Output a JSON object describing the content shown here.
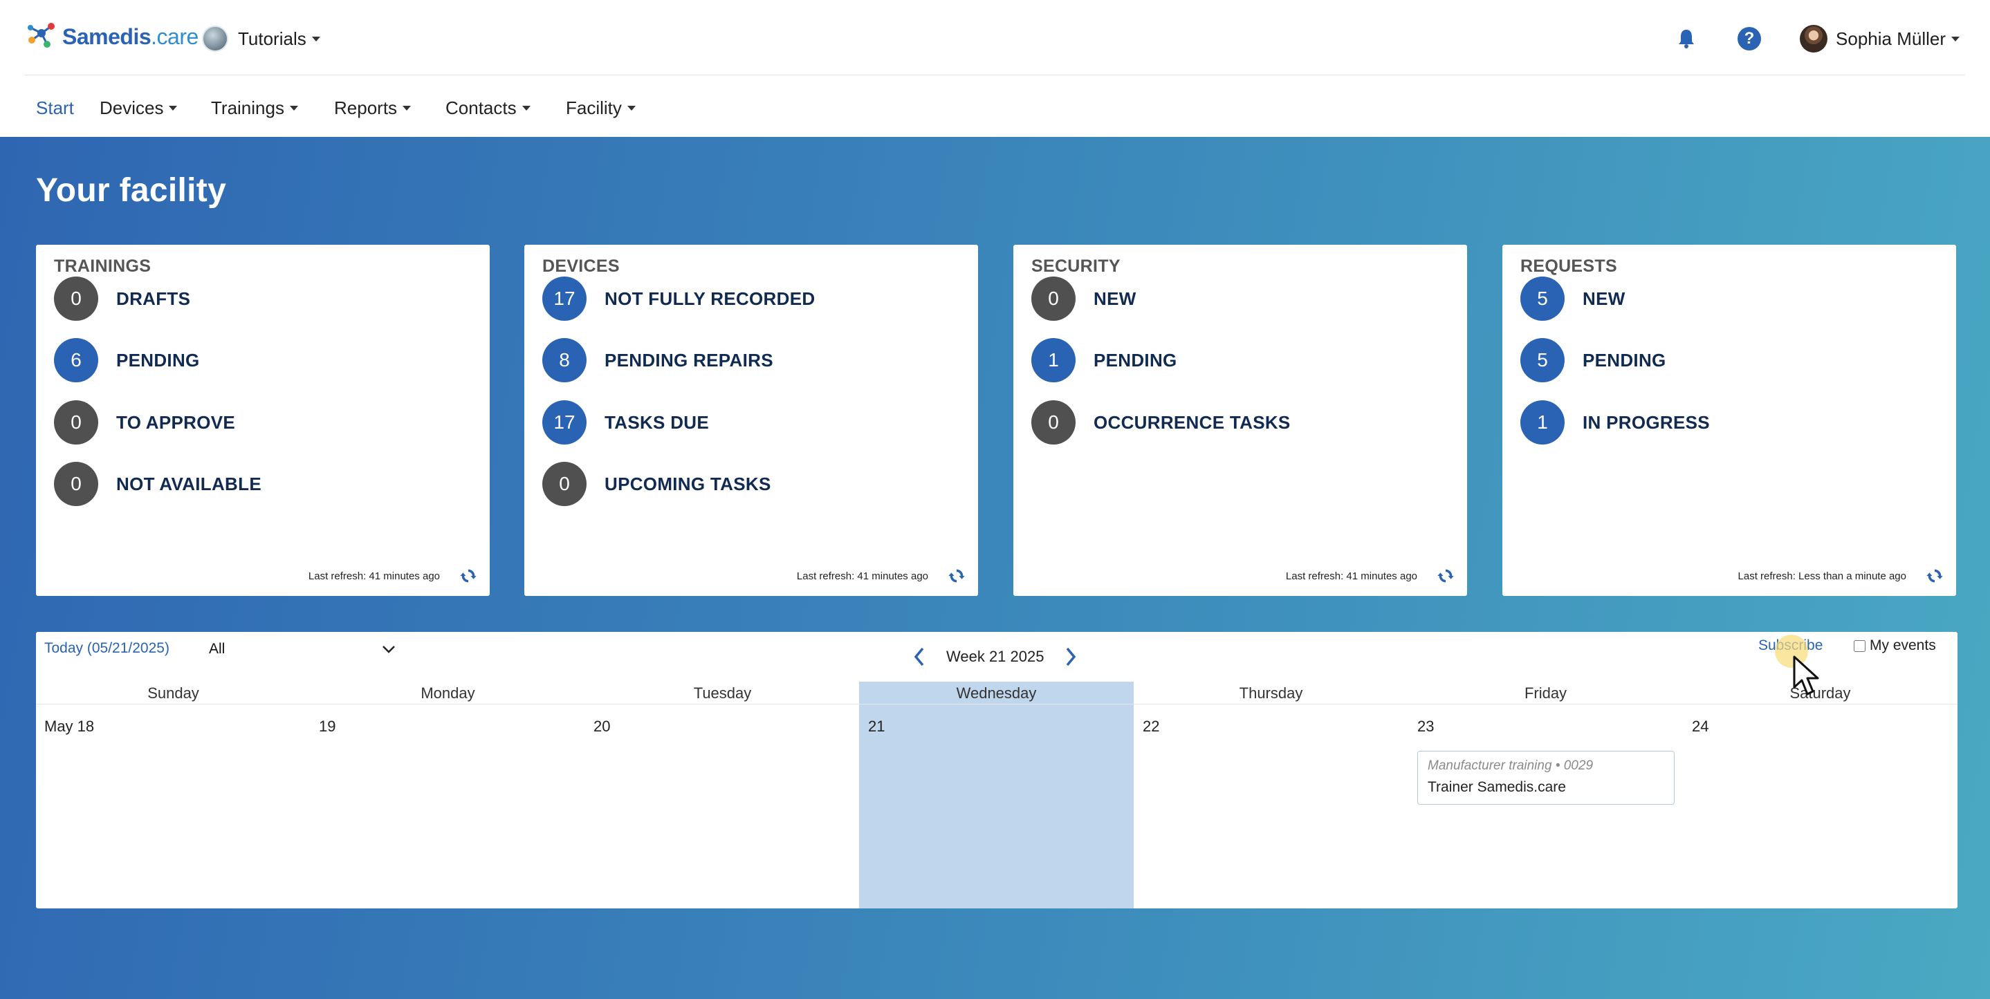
{
  "header": {
    "logo": {
      "part1": "Samedis",
      "part2": ".care"
    },
    "tenant": {
      "label": "Tutorials"
    },
    "user": {
      "name": "Sophia Müller"
    }
  },
  "nav": {
    "items": [
      {
        "label": "Start",
        "active": true
      },
      {
        "label": "Devices"
      },
      {
        "label": "Trainings"
      },
      {
        "label": "Reports"
      },
      {
        "label": "Contacts"
      },
      {
        "label": "Facility"
      }
    ]
  },
  "page": {
    "title": "Your facility"
  },
  "cards": [
    {
      "title": "TRAININGS",
      "stats": [
        {
          "count": "0",
          "label": "DRAFTS",
          "color": "gray"
        },
        {
          "count": "6",
          "label": "PENDING",
          "color": "blue"
        },
        {
          "count": "0",
          "label": "TO APPROVE",
          "color": "gray"
        },
        {
          "count": "0",
          "label": "NOT AVAILABLE",
          "color": "gray"
        }
      ],
      "refresh": "Last refresh: 41 minutes ago"
    },
    {
      "title": "DEVICES",
      "stats": [
        {
          "count": "17",
          "label": "NOT FULLY RECORDED",
          "color": "blue"
        },
        {
          "count": "8",
          "label": "PENDING REPAIRS",
          "color": "blue"
        },
        {
          "count": "17",
          "label": "TASKS DUE",
          "color": "blue"
        },
        {
          "count": "0",
          "label": "UPCOMING TASKS",
          "color": "gray"
        }
      ],
      "refresh": "Last refresh: 41 minutes ago"
    },
    {
      "title": "SECURITY",
      "stats": [
        {
          "count": "0",
          "label": "NEW",
          "color": "gray"
        },
        {
          "count": "1",
          "label": "PENDING",
          "color": "blue"
        },
        {
          "count": "0",
          "label": "OCCURRENCE TASKS",
          "color": "gray"
        }
      ],
      "refresh": "Last refresh: 41 minutes ago"
    },
    {
      "title": "REQUESTS",
      "stats": [
        {
          "count": "5",
          "label": "NEW",
          "color": "blue"
        },
        {
          "count": "5",
          "label": "PENDING",
          "color": "blue"
        },
        {
          "count": "1",
          "label": "IN PROGRESS",
          "color": "blue"
        }
      ],
      "refresh": "Last refresh: Less than a minute ago"
    }
  ],
  "calendar": {
    "today": "Today (05/21/2025)",
    "filter": "All",
    "week": "Week 21 2025",
    "subscribe": "Subscribe",
    "my_events": "My events",
    "days": [
      {
        "name": "Sunday",
        "num": "May 18"
      },
      {
        "name": "Monday",
        "num": "19"
      },
      {
        "name": "Tuesday",
        "num": "20"
      },
      {
        "name": "Wednesday",
        "num": "21",
        "today": true
      },
      {
        "name": "Thursday",
        "num": "22"
      },
      {
        "name": "Friday",
        "num": "23"
      },
      {
        "name": "Saturday",
        "num": "24"
      }
    ],
    "event": {
      "type": "Manufacturer training • 0029",
      "title": "Trainer Samedis.care"
    }
  },
  "colors": {
    "primary": "#2a63b3",
    "badge_gray": "#505050",
    "today_col": "#c0d6ec"
  }
}
